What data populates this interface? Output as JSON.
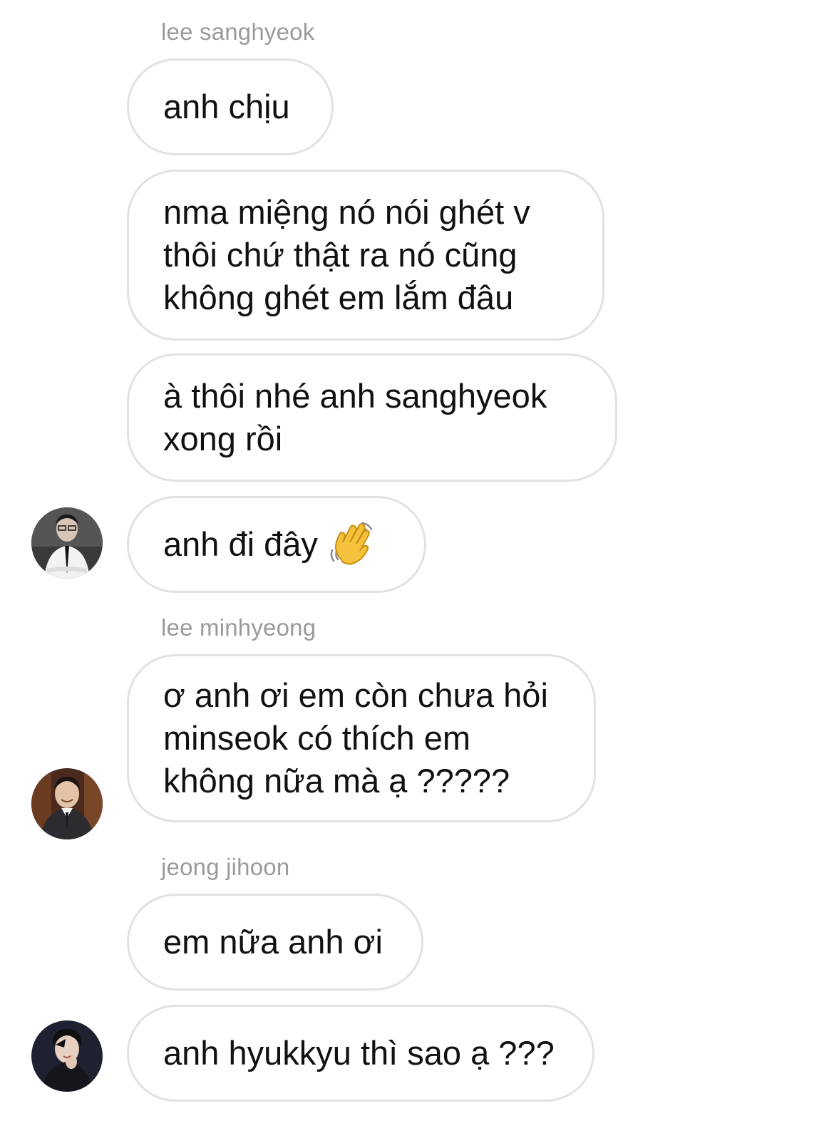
{
  "thread": {
    "senders": [
      "lee sanghyeok",
      "lee minhyeong",
      "jeong jihoon"
    ],
    "messages": [
      "anh chịu",
      "nma miệng nó nói ghét v\nthôi chứ thật ra nó cũng\nkhông ghét em lắm đâu",
      "à thôi nhé anh sanghyeok\nxong rồi",
      "anh đi đây",
      "ơ anh ơi em còn chưa hỏi\nminseok có thích em\nkhông nữa mà ạ ?????",
      "em nữa anh ơi",
      "anh hyukkyu thì sao ạ ???"
    ],
    "emoji": "waving-hand",
    "colors": {
      "bubble_border": "#e2e2e2",
      "sender_label": "#9a9a9a",
      "text": "#111111",
      "background": "#ffffff"
    }
  }
}
